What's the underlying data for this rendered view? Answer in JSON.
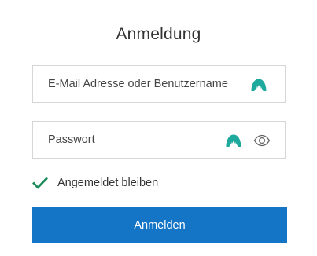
{
  "form": {
    "title": "Anmeldung",
    "username": {
      "placeholder": "E-Mail Adresse oder Benutzername",
      "value": ""
    },
    "password": {
      "placeholder": "Passwort",
      "value": ""
    },
    "remember_me": {
      "label": "Angemeldet bleiben",
      "checked": true
    },
    "submit_label": "Anmelden"
  },
  "icons": {
    "autofill": "nordpass-autofill-icon",
    "show_password": "eye-icon",
    "checkmark": "checkmark-icon"
  },
  "colors": {
    "primary_button": "#1474c6",
    "autofill_icon": "#1ea99d",
    "checkmark": "#1b8a5a",
    "field_border": "#d6d6d6",
    "text": "#333333"
  }
}
